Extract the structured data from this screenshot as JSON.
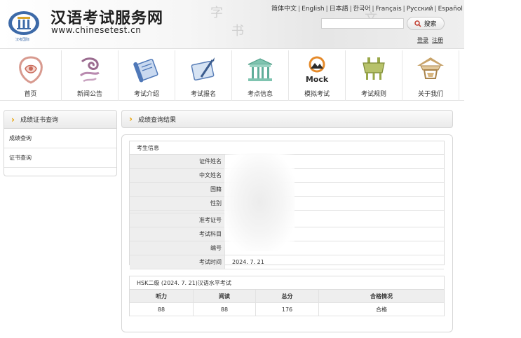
{
  "header": {
    "site_title": "汉语考试服务网",
    "site_url": "www.chinesetest.cn",
    "logo_caption": "汉考国际",
    "languages": [
      "简体中文",
      "English",
      "日本語",
      "한국어",
      "Français",
      "Русский",
      "Español"
    ],
    "search_label": "搜索",
    "search_placeholder": "",
    "login_label": "登录",
    "register_label": "注册"
  },
  "nav": [
    {
      "label": "首页",
      "icon": "home-icon"
    },
    {
      "label": "新闻公告",
      "icon": "news-icon"
    },
    {
      "label": "考试介绍",
      "icon": "scroll-icon"
    },
    {
      "label": "考试报名",
      "icon": "registration-icon"
    },
    {
      "label": "考点信息",
      "icon": "building-icon"
    },
    {
      "label": "模拟考试",
      "icon": "mock-icon",
      "icon_text": "Mock"
    },
    {
      "label": "考试规则",
      "icon": "ding-icon"
    },
    {
      "label": "关于我们",
      "icon": "pavilion-icon"
    }
  ],
  "sidebar": {
    "title": "成绩证书查询",
    "items": [
      {
        "label": "成绩查询"
      },
      {
        "label": "证书查询"
      }
    ]
  },
  "main": {
    "title": "成绩查询结果",
    "candidate": {
      "section_title": "考生信息",
      "fields": [
        {
          "label": "证件姓名",
          "value": ""
        },
        {
          "label": "中文姓名",
          "value": ""
        },
        {
          "label": "国籍",
          "value": ""
        },
        {
          "label": "性别",
          "value": ""
        },
        {
          "label": "准考证号",
          "value": ""
        },
        {
          "label": "考试科目",
          "value": ""
        },
        {
          "label": "编号",
          "value": ""
        },
        {
          "label": "考试时间",
          "value": "2024. 7. 21"
        }
      ]
    },
    "scores": {
      "title": "HSK二级 (2024. 7. 21)汉语水平考试",
      "headers": [
        "听力",
        "阅读",
        "总分",
        "合格情况"
      ],
      "row": [
        "88",
        "88",
        "176",
        "合格"
      ]
    }
  },
  "colors": {
    "accent_chevron": "#e8a100",
    "nav_icon_red": "#c96a5a",
    "nav_icon_blue": "#4f78b8",
    "nav_icon_green": "#5fae9a",
    "nav_icon_olive": "#9aa84a",
    "nav_icon_orange": "#e58a2a"
  }
}
